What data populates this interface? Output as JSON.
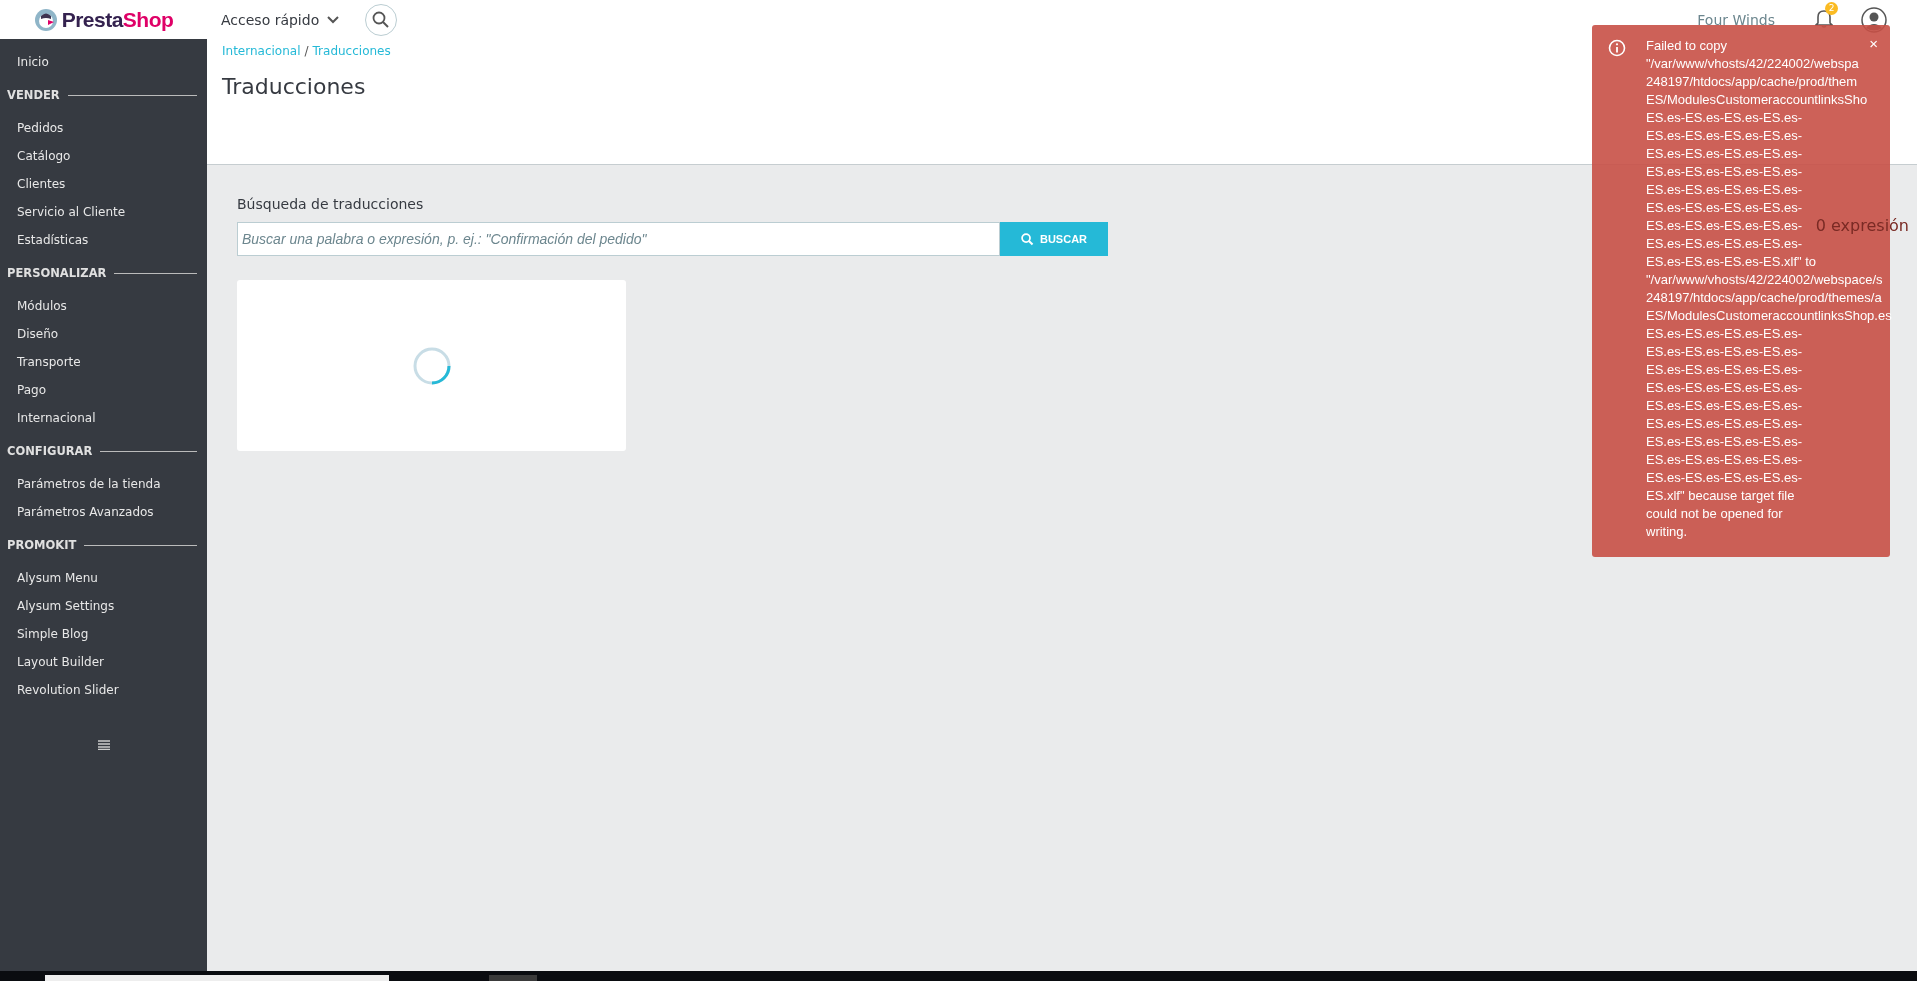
{
  "header": {
    "logo": {
      "part_1": "Presta",
      "part_2": "Shop"
    },
    "quick_access": "Acceso rápido",
    "shop_name": "Four Winds",
    "notification_count": "2"
  },
  "sidebar": {
    "items": [
      {
        "kind": "link",
        "label": "Inicio"
      },
      {
        "kind": "section",
        "label": "VENDER"
      },
      {
        "kind": "link",
        "label": "Pedidos"
      },
      {
        "kind": "link",
        "label": "Catálogo"
      },
      {
        "kind": "link",
        "label": "Clientes"
      },
      {
        "kind": "link",
        "label": "Servicio al Cliente"
      },
      {
        "kind": "link",
        "label": "Estadísticas"
      },
      {
        "kind": "section",
        "label": "PERSONALIZAR"
      },
      {
        "kind": "link",
        "label": "Módulos"
      },
      {
        "kind": "link",
        "label": "Diseño"
      },
      {
        "kind": "link",
        "label": "Transporte"
      },
      {
        "kind": "link",
        "label": "Pago"
      },
      {
        "kind": "link",
        "label": "Internacional"
      },
      {
        "kind": "section",
        "label": "CONFIGURAR"
      },
      {
        "kind": "link",
        "label": "Parámetros de la tienda"
      },
      {
        "kind": "link",
        "label": "Parámetros Avanzados"
      },
      {
        "kind": "section",
        "label": "PROMOKIT"
      },
      {
        "kind": "link",
        "label": "Alysum Menu"
      },
      {
        "kind": "link",
        "label": "Alysum Settings"
      },
      {
        "kind": "link",
        "label": "Simple Blog"
      },
      {
        "kind": "link",
        "label": "Layout Builder"
      },
      {
        "kind": "link",
        "label": "Revolution Slider"
      }
    ]
  },
  "breadcrumb": [
    "Internacional",
    "Traducciones"
  ],
  "breadcrumb_separator": "/",
  "page_title": "Traducciones",
  "search": {
    "label": "Búsqueda de traducciones",
    "placeholder": "Buscar una palabra o expresión, p. ej.: \"Confirmación del pedido\"",
    "button": "BUSCAR"
  },
  "result_count": "0 expresión",
  "toast": {
    "title": "Failed to copy",
    "lines": [
      "\"/var/www/vhosts/42/224002/webspa",
      "248197/htdocs/app/cache/prod/them",
      "ES/ModulesCustomeraccountlinksSho",
      "ES.es-ES.es-ES.es-ES.es-",
      "ES.es-ES.es-ES.es-ES.es-",
      "ES.es-ES.es-ES.es-ES.es-",
      "ES.es-ES.es-ES.es-ES.es-",
      "ES.es-ES.es-ES.es-ES.es-",
      "ES.es-ES.es-ES.es-ES.es-",
      "ES.es-ES.es-ES.es-ES.es-",
      "ES.es-ES.es-ES.es-ES.es-",
      "ES.es-ES.es-ES.es-ES.xlf\" to",
      "\"/var/www/vhosts/42/224002/webspace/s",
      "248197/htdocs/app/cache/prod/themes/a",
      "ES/ModulesCustomeraccountlinksShop.es",
      "ES.es-ES.es-ES.es-ES.es-",
      "ES.es-ES.es-ES.es-ES.es-",
      "ES.es-ES.es-ES.es-ES.es-",
      "ES.es-ES.es-ES.es-ES.es-",
      "ES.es-ES.es-ES.es-ES.es-",
      "ES.es-ES.es-ES.es-ES.es-",
      "ES.es-ES.es-ES.es-ES.es-",
      "ES.es-ES.es-ES.es-ES.es-",
      "ES.es-ES.es-ES.es-ES.es-",
      "ES.xlf\" because target file",
      "could not be opened for",
      "writing."
    ],
    "close": "×"
  }
}
